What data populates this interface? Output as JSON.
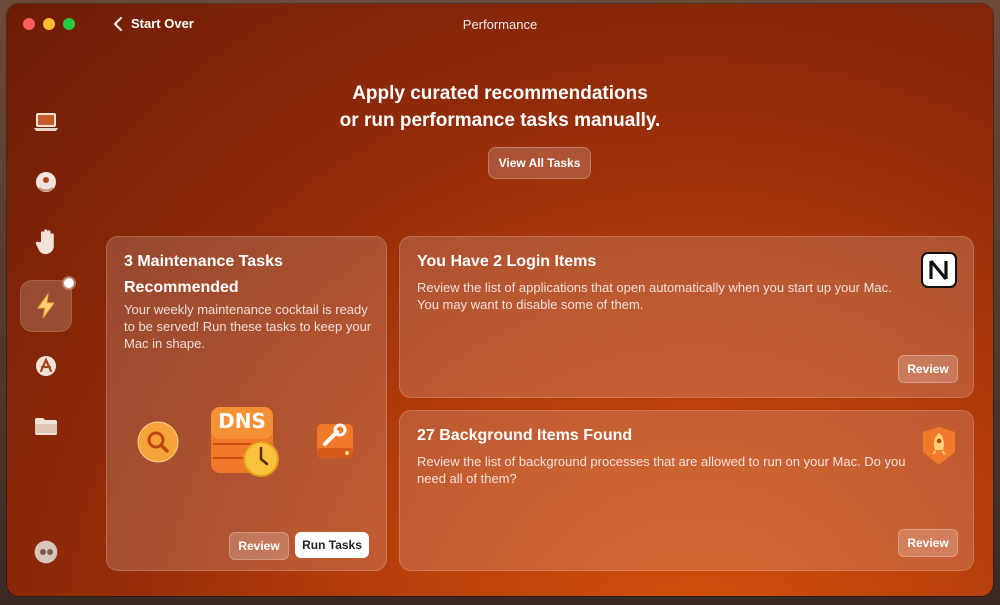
{
  "window": {
    "title": "Performance",
    "back_label": "Start Over"
  },
  "sidebar": {
    "items": [
      {
        "icon": "laptop-icon"
      },
      {
        "icon": "shield-icon"
      },
      {
        "icon": "hand-icon"
      },
      {
        "icon": "lightning-icon",
        "active": true
      },
      {
        "icon": "app-store-icon"
      },
      {
        "icon": "folder-icon"
      },
      {
        "icon": "assistant-icon"
      }
    ]
  },
  "main": {
    "headline_line1": "Apply curated recommendations",
    "headline_line2": "or run performance tasks manually.",
    "view_all_label": "View All Tasks"
  },
  "maintenance_card": {
    "title": "3 Maintenance Tasks Recommended",
    "description": "Your weekly maintenance cocktail is ready to be served! Run these tasks to keep your Mac in shape.",
    "dns_label": "DNS",
    "review_label": "Review",
    "run_label": "Run Tasks"
  },
  "login_card": {
    "title": "You Have 2 Login Items",
    "description": "Review the list of applications that open automatically when you start up your Mac. You may want to disable some of them.",
    "review_label": "Review"
  },
  "background_card": {
    "title": "27 Background Items Found",
    "description": "Review the list of background processes that are allowed to run on your Mac. Do you need all of them?",
    "review_label": "Review"
  },
  "colors": {
    "accent": "#c24410",
    "window_dark": "#6b1c06"
  }
}
